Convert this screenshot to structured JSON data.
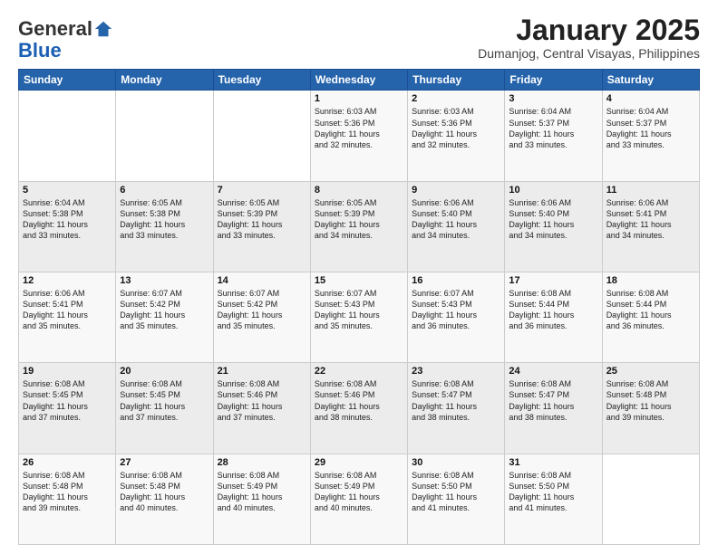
{
  "logo": {
    "general": "General",
    "blue": "Blue"
  },
  "title": "January 2025",
  "subtitle": "Dumanjog, Central Visayas, Philippines",
  "days_header": [
    "Sunday",
    "Monday",
    "Tuesday",
    "Wednesday",
    "Thursday",
    "Friday",
    "Saturday"
  ],
  "weeks": [
    [
      {
        "day": "",
        "info": ""
      },
      {
        "day": "",
        "info": ""
      },
      {
        "day": "",
        "info": ""
      },
      {
        "day": "1",
        "info": "Sunrise: 6:03 AM\nSunset: 5:36 PM\nDaylight: 11 hours\nand 32 minutes."
      },
      {
        "day": "2",
        "info": "Sunrise: 6:03 AM\nSunset: 5:36 PM\nDaylight: 11 hours\nand 32 minutes."
      },
      {
        "day": "3",
        "info": "Sunrise: 6:04 AM\nSunset: 5:37 PM\nDaylight: 11 hours\nand 33 minutes."
      },
      {
        "day": "4",
        "info": "Sunrise: 6:04 AM\nSunset: 5:37 PM\nDaylight: 11 hours\nand 33 minutes."
      }
    ],
    [
      {
        "day": "5",
        "info": "Sunrise: 6:04 AM\nSunset: 5:38 PM\nDaylight: 11 hours\nand 33 minutes."
      },
      {
        "day": "6",
        "info": "Sunrise: 6:05 AM\nSunset: 5:38 PM\nDaylight: 11 hours\nand 33 minutes."
      },
      {
        "day": "7",
        "info": "Sunrise: 6:05 AM\nSunset: 5:39 PM\nDaylight: 11 hours\nand 33 minutes."
      },
      {
        "day": "8",
        "info": "Sunrise: 6:05 AM\nSunset: 5:39 PM\nDaylight: 11 hours\nand 34 minutes."
      },
      {
        "day": "9",
        "info": "Sunrise: 6:06 AM\nSunset: 5:40 PM\nDaylight: 11 hours\nand 34 minutes."
      },
      {
        "day": "10",
        "info": "Sunrise: 6:06 AM\nSunset: 5:40 PM\nDaylight: 11 hours\nand 34 minutes."
      },
      {
        "day": "11",
        "info": "Sunrise: 6:06 AM\nSunset: 5:41 PM\nDaylight: 11 hours\nand 34 minutes."
      }
    ],
    [
      {
        "day": "12",
        "info": "Sunrise: 6:06 AM\nSunset: 5:41 PM\nDaylight: 11 hours\nand 35 minutes."
      },
      {
        "day": "13",
        "info": "Sunrise: 6:07 AM\nSunset: 5:42 PM\nDaylight: 11 hours\nand 35 minutes."
      },
      {
        "day": "14",
        "info": "Sunrise: 6:07 AM\nSunset: 5:42 PM\nDaylight: 11 hours\nand 35 minutes."
      },
      {
        "day": "15",
        "info": "Sunrise: 6:07 AM\nSunset: 5:43 PM\nDaylight: 11 hours\nand 35 minutes."
      },
      {
        "day": "16",
        "info": "Sunrise: 6:07 AM\nSunset: 5:43 PM\nDaylight: 11 hours\nand 36 minutes."
      },
      {
        "day": "17",
        "info": "Sunrise: 6:08 AM\nSunset: 5:44 PM\nDaylight: 11 hours\nand 36 minutes."
      },
      {
        "day": "18",
        "info": "Sunrise: 6:08 AM\nSunset: 5:44 PM\nDaylight: 11 hours\nand 36 minutes."
      }
    ],
    [
      {
        "day": "19",
        "info": "Sunrise: 6:08 AM\nSunset: 5:45 PM\nDaylight: 11 hours\nand 37 minutes."
      },
      {
        "day": "20",
        "info": "Sunrise: 6:08 AM\nSunset: 5:45 PM\nDaylight: 11 hours\nand 37 minutes."
      },
      {
        "day": "21",
        "info": "Sunrise: 6:08 AM\nSunset: 5:46 PM\nDaylight: 11 hours\nand 37 minutes."
      },
      {
        "day": "22",
        "info": "Sunrise: 6:08 AM\nSunset: 5:46 PM\nDaylight: 11 hours\nand 38 minutes."
      },
      {
        "day": "23",
        "info": "Sunrise: 6:08 AM\nSunset: 5:47 PM\nDaylight: 11 hours\nand 38 minutes."
      },
      {
        "day": "24",
        "info": "Sunrise: 6:08 AM\nSunset: 5:47 PM\nDaylight: 11 hours\nand 38 minutes."
      },
      {
        "day": "25",
        "info": "Sunrise: 6:08 AM\nSunset: 5:48 PM\nDaylight: 11 hours\nand 39 minutes."
      }
    ],
    [
      {
        "day": "26",
        "info": "Sunrise: 6:08 AM\nSunset: 5:48 PM\nDaylight: 11 hours\nand 39 minutes."
      },
      {
        "day": "27",
        "info": "Sunrise: 6:08 AM\nSunset: 5:48 PM\nDaylight: 11 hours\nand 40 minutes."
      },
      {
        "day": "28",
        "info": "Sunrise: 6:08 AM\nSunset: 5:49 PM\nDaylight: 11 hours\nand 40 minutes."
      },
      {
        "day": "29",
        "info": "Sunrise: 6:08 AM\nSunset: 5:49 PM\nDaylight: 11 hours\nand 40 minutes."
      },
      {
        "day": "30",
        "info": "Sunrise: 6:08 AM\nSunset: 5:50 PM\nDaylight: 11 hours\nand 41 minutes."
      },
      {
        "day": "31",
        "info": "Sunrise: 6:08 AM\nSunset: 5:50 PM\nDaylight: 11 hours\nand 41 minutes."
      },
      {
        "day": "",
        "info": ""
      }
    ]
  ]
}
